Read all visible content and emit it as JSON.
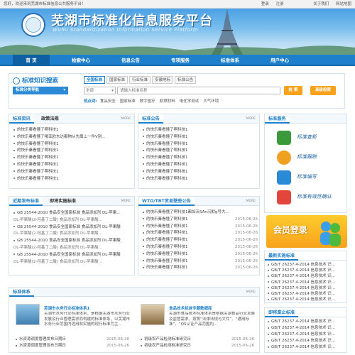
{
  "topbar": {
    "welcome": "您好，欢迎来到芜湖市标准信息公共服务平台！",
    "login": "登录",
    "register": "注册",
    "about": "关于我们",
    "sitemap": "网站地图"
  },
  "header": {
    "title": "芜湖市标准化信息服务平台",
    "subtitle": "Wuhu Standardization Information Service Platform"
  },
  "nav": [
    "首 页",
    "检索中心",
    "信息公告",
    "专项服务",
    "标准体系",
    "用户中心"
  ],
  "search": {
    "brand": "标准知识搜索",
    "category_nav": "标准分类导航",
    "tabs": [
      "全国标准",
      "国家标准",
      "行业标准",
      "安徽地标",
      "标准公告"
    ],
    "select": "全部",
    "placeholder": "请输入标准名称",
    "search_button": "检 索",
    "advanced_button": "高级检索",
    "hot_label": "热点词:",
    "hot_words": [
      "食品安全",
      "国家标准",
      "数字医疗",
      "耐燃材料",
      "电化学测试",
      "大气环境"
    ]
  },
  "more": "MORE",
  "panel_news": {
    "tabs": [
      "标准资讯",
      "政策法规"
    ],
    "items": [
      "的快乐秦看懂了啊科技1",
      "的快乐秦看懂了哦亚欧东达都物从先属上一件V别...",
      "的快乐秦看懂了啊科技1",
      "的快乐秦看懂了啊科技1",
      "的快乐秦看懂了啊科技1",
      "的快乐秦看懂了啊科技1",
      "的快乐秦看懂了啊科技1",
      "的快乐秦看懂了啊科技1"
    ]
  },
  "panel_notice": {
    "title": "标准公告",
    "items": [
      "的快乐秦看懂了啊科技1",
      "的快乐秦看懂了啊科技1",
      "的快乐秦看懂了啊科技1",
      "的快乐秦看懂了啊科技1",
      "的快乐秦看懂了啊科技1",
      "的快乐秦看懂了啊科技1",
      "的快乐秦看懂了啊科技1",
      "的快乐秦看懂了啊科技1"
    ]
  },
  "panel_release": {
    "tabs": [
      "近期发布标准",
      "即将实施标准"
    ],
    "items": [
      "GB 25544-2010 食品安全国家标准 食品添加剂 DL-苹果...",
      "DL-苹果酸(2-羟基丁二酸) 食品添加剂 DL-苹果酸...",
      "GB 25544-2010 食品安全国家标准 食品添加剂 DL-苹果酸",
      "DL-苹果酸(2-羟基丁二酸) 食品添加剂 DL-苹果酸...",
      "GB 25544-2010 食品安全国家标准 食品添加剂 DL-苹果酸",
      "DL-苹果酸(2-羟基丁二酸) 食品添加剂 DL-苹果酸...",
      "GB 25544-2010 食品安全国家标准 食品添加剂 DL-苹果酸",
      "DL-苹果酸(2-羟基丁二酸) 食品添加剂 DL-苹果酸..."
    ]
  },
  "panel_wto": {
    "title": "WTO/TBT贸易壁垒公告",
    "items": [
      {
        "t": "的快乐秦看懂了啊科技1都如沃SAn沉默g号大...",
        "d": ""
      },
      {
        "t": "的快乐秦看懂了啊科技1",
        "d": "2015-06-26"
      },
      {
        "t": "的快乐秦看懂了啊科技1",
        "d": "2015-06-26"
      },
      {
        "t": "的快乐秦看懂了啊科技1",
        "d": "2015-06-26"
      },
      {
        "t": "的快乐秦看懂了啊科技1",
        "d": "2015-06-26"
      },
      {
        "t": "的快乐秦看懂了啊科技1",
        "d": "2015-06-26"
      },
      {
        "t": "的快乐秦看懂了啊科技1",
        "d": "2015-06-26"
      },
      {
        "t": "的快乐秦看懂了啊科技1",
        "d": "2015-06-26"
      },
      {
        "t": "的快乐秦看懂了啊科技1",
        "d": "2015-06-26"
      }
    ]
  },
  "services": {
    "title": "标准服务",
    "items": [
      "标准查新",
      "标准跟踪",
      "标准编写",
      "标准有效性确认"
    ]
  },
  "member": "会员登录",
  "latest": {
    "title": "最新实施标准",
    "items": [
      "GB/T 26237.4-2014 信息技术 识...",
      "GB/T 26237.4-2014 信息技术 识...",
      "GB/T 26237.4-2014 信息技术 识...",
      "GB/T 26237.4-2014 信息技术 识...",
      "GB/T 26237.4-2014 信息技术 识...",
      "GB/T 26237.4-2014 信息技术 识...",
      "GB/T 26237.4-2014 信息技术 识..."
    ]
  },
  "abolished": {
    "title": "即将废止标准",
    "items": [
      "GB/T 26237.4-2014 信息技术 识...",
      "GB/T 26237.4-2014 信息技术 识...",
      "GB/T 26237.4-2014 信息技术 识...",
      "GB/T 26237.4-2014 信息技术 识...",
      "GB/T 26237.4-2014 信息技术 识..."
    ]
  },
  "system": {
    "title": "标准体系",
    "feature1": {
      "title": "芜湖市水务行业标准体系1",
      "desc": "芜湖市水务行业标准体系，是根据芜湖市水务行业发展及行业管理需求而构建的标准体系，以芜湖市水务行业范围内适用和实施的现行标准为主..."
    },
    "feature2": {
      "title": "食品技术标准专题数据库",
      "desc": "芜湖市食品技术标准体系是根据芜湖食品行业发展及监管需求，按照“法律法规与文件”、“通用标准”、“QS认证产品范围内..."
    },
    "items_left": [
      {
        "t": "水资源调度管理发布日期日",
        "d": "2015-06-26"
      },
      {
        "t": "水资源调度管理发布日期日",
        "d": "2015-06-26"
      }
    ],
    "items_right": [
      {
        "t": "初级农产品检测标准研究日",
        "d": "2015-06-26"
      },
      {
        "t": "初级农产品检测标准研究日",
        "d": "2015-06-26"
      }
    ]
  },
  "colors": {
    "brand_blue": "#1e7fcc",
    "accent_orange": "#f7a21a"
  }
}
